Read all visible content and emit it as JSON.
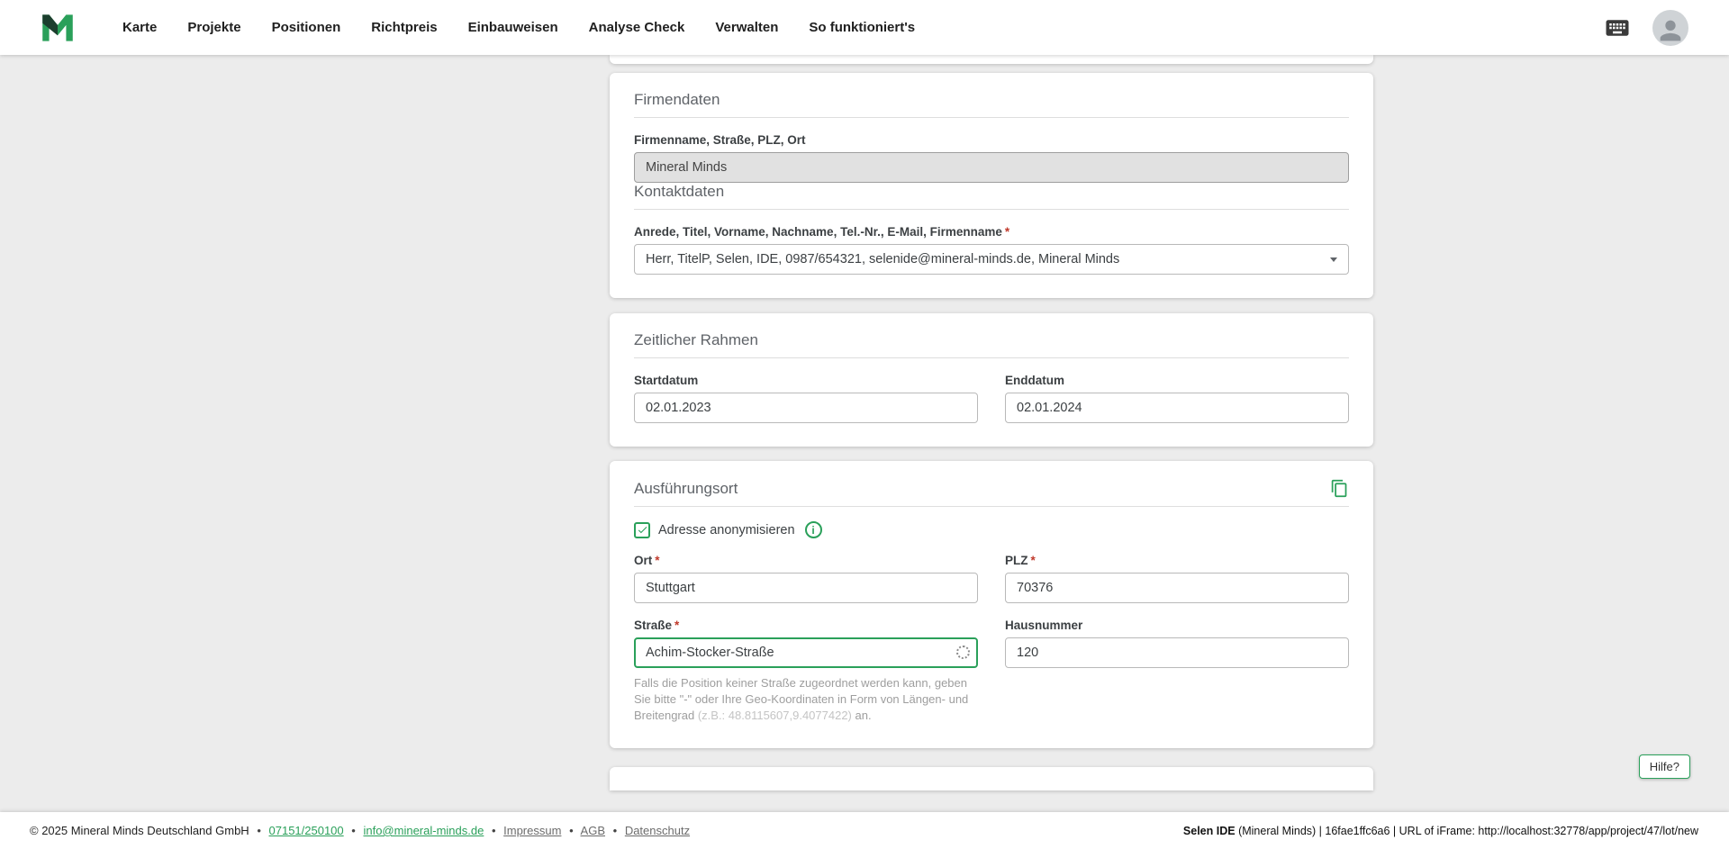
{
  "navbar": {
    "items": [
      "Karte",
      "Projekte",
      "Positionen",
      "Richtpreis",
      "Einbauweisen",
      "Analyse Check",
      "Verwalten",
      "So funktioniert's"
    ]
  },
  "required_marker": "*",
  "firmendaten": {
    "title": "Firmendaten",
    "company_label": "Firmenname, Straße, PLZ, Ort",
    "company_value": "Mineral Minds",
    "kontakt_title": "Kontaktdaten",
    "kontakt_label": "Anrede, Titel, Vorname, Nachname, Tel.-Nr., E-Mail, Firmenname",
    "kontakt_value": "Herr, TitelP, Selen, IDE, 0987/654321, selenide@mineral-minds.de, Mineral Minds"
  },
  "zeitraum": {
    "title": "Zeitlicher Rahmen",
    "start_label": "Startdatum",
    "start_value": "02.01.2023",
    "end_label": "Enddatum",
    "end_value": "02.01.2024"
  },
  "ausfuehrungsort": {
    "title": "Ausführungsort",
    "anonymize_label": "Adresse anonymisieren",
    "ort_label": "Ort",
    "ort_value": "Stuttgart",
    "plz_label": "PLZ",
    "plz_value": "70376",
    "strasse_label": "Straße",
    "strasse_value": "Achim-Stocker-Straße",
    "hausnummer_label": "Hausnummer",
    "hausnummer_value": "120",
    "hint_text": "Falls die Position keiner Straße zugeordnet werden kann, geben Sie bitte \"-\" oder Ihre Geo-Koordinaten in Form von Längen- und Breitengrad ",
    "hint_example": "(z.B.: 48.8115607,9.4077422)",
    "hint_suffix": " an."
  },
  "help_button_label": "Hilfe?",
  "footer": {
    "copyright": "© 2025 Mineral Minds Deutschland GmbH",
    "separator": "•",
    "phone_link": "07151/250100",
    "email_link": "info@mineral-minds.de",
    "impressum_link": "Impressum",
    "agb_link": "AGB",
    "datenschutz_link": "Datenschutz",
    "ide_name": "Selen IDE",
    "ide_info": " (Mineral Minds) | 16fae1ffc6a6 | URL of iFrame: http://localhost:32778/app/project/47/lot/new"
  },
  "colors": {
    "accent_green": "#2aa05a"
  }
}
